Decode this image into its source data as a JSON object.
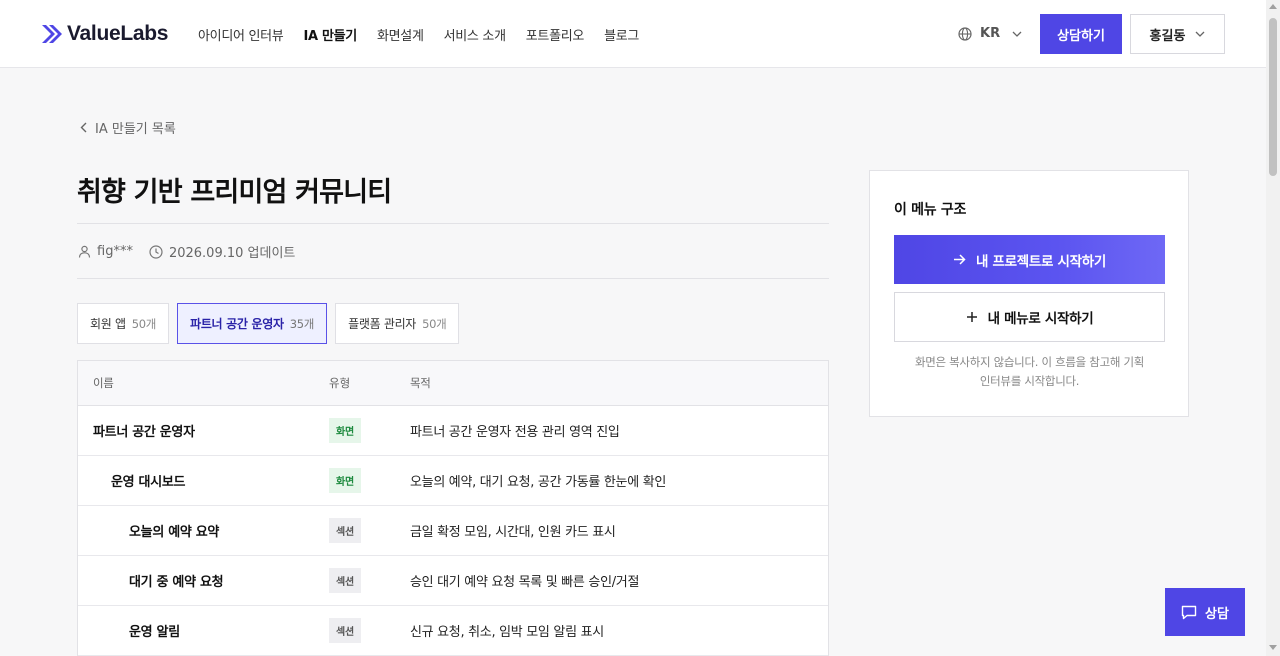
{
  "header": {
    "logo_text": "ValueLabs",
    "nav": [
      {
        "label": "아이디어 인터뷰"
      },
      {
        "label": "IA 만들기"
      },
      {
        "label": "화면설계"
      },
      {
        "label": "서비스 소개"
      },
      {
        "label": "포트폴리오"
      },
      {
        "label": "블로그"
      }
    ],
    "active_nav": "IA 만들기",
    "lang": "KR",
    "cta_label": "상담하기",
    "user_name": "홍길동"
  },
  "page": {
    "back_label": "IA 만들기 목록",
    "title": "취향 기반 프리미엄 커뮤니티",
    "author": "fig***",
    "updated": "2026.09.10 업데이트"
  },
  "tabs": [
    {
      "label": "회원 앱",
      "count": "50개"
    },
    {
      "label": "파트너 공간 운영자",
      "count": "35개"
    },
    {
      "label": "플랫폼 관리자",
      "count": "50개"
    }
  ],
  "table": {
    "headers": {
      "name": "이름",
      "type": "유형",
      "purpose": "목적"
    },
    "rows": [
      {
        "name": "파트너 공간 운영자",
        "type": "화면",
        "purpose": "파트너 공간 운영자 전용 관리 영역 진입"
      },
      {
        "name": "운영 대시보드",
        "type": "화면",
        "purpose": "오늘의 예약, 대기 요청, 공간 가동률 한눈에 확인"
      },
      {
        "name": "오늘의 예약 요약",
        "type": "섹션",
        "purpose": "금일 확정 모임, 시간대, 인원 카드 표시"
      },
      {
        "name": "대기 중 예약 요청",
        "type": "섹션",
        "purpose": "승인 대기 예약 요청 목록 및 빠른 승인/거절"
      },
      {
        "name": "운영 알림",
        "type": "섹션",
        "purpose": "신규 요청, 취소, 임박 모임 알림 표시"
      }
    ]
  },
  "sidebar_card": {
    "title": "이 메뉴 구조",
    "primary_label": "내 프로젝트로 시작하기",
    "secondary_label": "내 메뉴로 시작하기",
    "note_line1": "화면은 복사하지 않습니다. 이 흐름을 참고해 기획",
    "note_line2": "인터뷰를 시작합니다."
  },
  "chat_label": "상담",
  "colors": {
    "accent": "#4f46e5",
    "screen_badge": "#1d8a3e"
  }
}
